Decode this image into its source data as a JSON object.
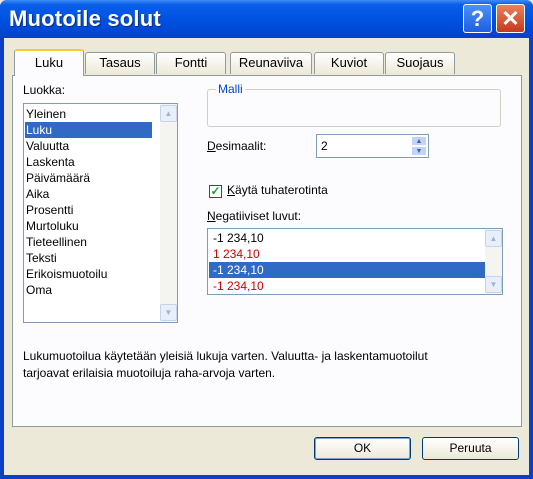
{
  "dialog": {
    "title": "Muotoile solut",
    "help_label": "?",
    "close_label": "✕"
  },
  "tabs": [
    "Luku",
    "Tasaus",
    "Fontti",
    "Reunaviiva",
    "Kuviot",
    "Suojaus"
  ],
  "category": {
    "label": "Luokka:",
    "items": [
      "Yleinen",
      "Luku",
      "Valuutta",
      "Laskenta",
      "Päivämäärä",
      "Aika",
      "Prosentti",
      "Murtoluku",
      "Tieteellinen",
      "Teksti",
      "Erikoismuotoilu",
      "Oma"
    ],
    "selected": "Luku"
  },
  "sample": {
    "label": "Malli",
    "value": ""
  },
  "decimals": {
    "label": "Desimaalit:",
    "value": "2"
  },
  "separator": {
    "label": "Käytä tuhaterotinta",
    "checked": true
  },
  "negative": {
    "label": "Negatiiviset luvut:",
    "items": [
      "-1 234,10",
      "1 234,10",
      "-1 234,10",
      "-1 234,10"
    ],
    "selected_index": 2,
    "red_indices": [
      1,
      3
    ]
  },
  "description": "Lukumuotoilua käytetään yleisiä lukuja varten. Valuutta- ja laskentamuotoilut tarjoavat erilaisia muotoiluja raha-arvoja varten.",
  "buttons": {
    "ok": "OK",
    "cancel": "Peruuta"
  },
  "colors": {
    "title_bar": "#0054e3",
    "selection": "#316ac5",
    "negative_red": "#cc0000",
    "active_tab_accent": "#ffc83c"
  }
}
